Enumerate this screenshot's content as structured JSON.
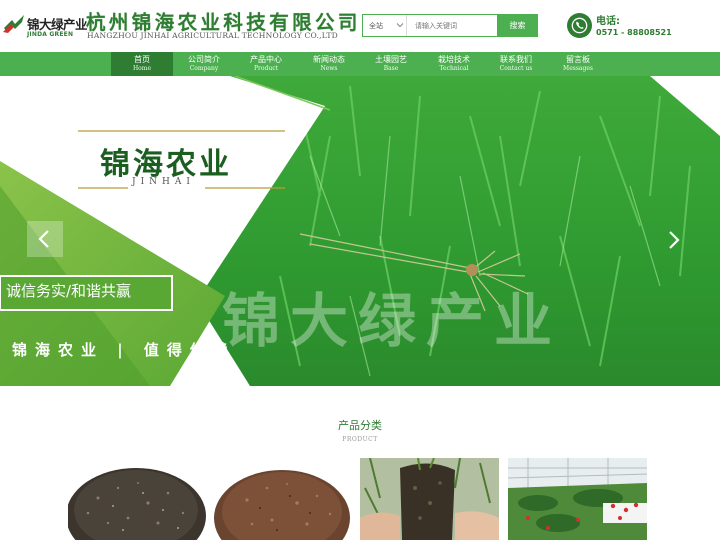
{
  "header": {
    "logo_cn": "锦大绿产业",
    "logo_en": "JINDA GREEN",
    "company_cn": "杭州锦海农业科技有限公司",
    "company_en": "HANGZHOU JINHAI AGRICULTURAL TECHNOLOGY CO.,LTD"
  },
  "search": {
    "scope": "全站",
    "placeholder": "请输入关键词",
    "button": "搜索"
  },
  "contact": {
    "label": "电话:",
    "number": "0571 - 88808521"
  },
  "nav": [
    {
      "cn": "首页",
      "en": "Home"
    },
    {
      "cn": "公司简介",
      "en": "Company"
    },
    {
      "cn": "产品中心",
      "en": "Product"
    },
    {
      "cn": "新闻动态",
      "en": "News"
    },
    {
      "cn": "土壤园艺",
      "en": "Base"
    },
    {
      "cn": "栽培技术",
      "en": "Technical"
    },
    {
      "cn": "联系我们",
      "en": "Contact us"
    },
    {
      "cn": "留言板",
      "en": "Messages"
    }
  ],
  "banner": {
    "brand_cn": "锦海农业",
    "brand_en": "JINHAI",
    "slogan_1": "诚信务实/和谐共赢",
    "slogan_2": "锦海农业 | 值得信赖",
    "watermark": "锦大绿产业"
  },
  "products": {
    "title": "产品分类",
    "subtitle": "PRODUCT",
    "items": [
      {
        "name": "potting-soil-dark"
      },
      {
        "name": "potting-soil-brown"
      },
      {
        "name": "seedling-plug"
      },
      {
        "name": "greenhouse-strawberry"
      }
    ]
  },
  "colors": {
    "primary_green": "#4caf50",
    "dark_green": "#2e7d32",
    "grass_green": "#3aa83a"
  }
}
